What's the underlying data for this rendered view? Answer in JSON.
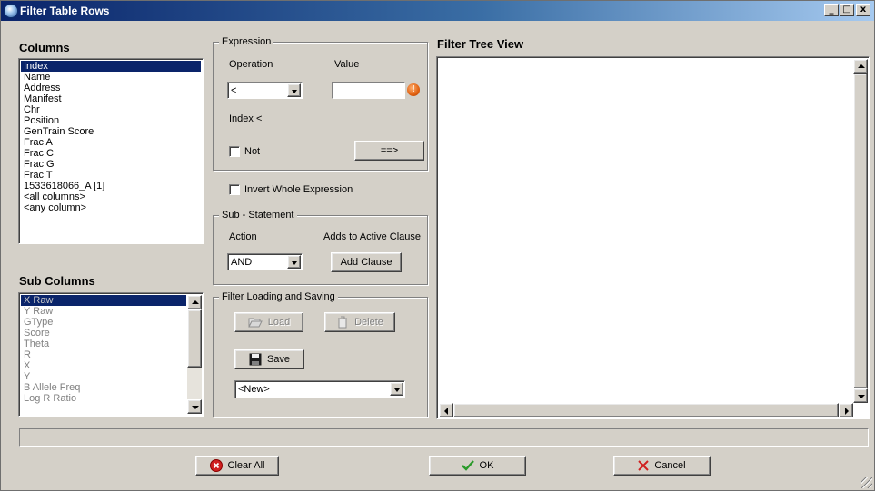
{
  "window": {
    "title": "Filter Table Rows"
  },
  "titlebar_buttons": {
    "minimize": "_",
    "maximize": "□",
    "close": "x"
  },
  "columns": {
    "heading": "Columns",
    "items": [
      "Index",
      "Name",
      "Address",
      "Manifest",
      "Chr",
      "Position",
      "GenTrain Score",
      "Frac A",
      "Frac C",
      "Frac G",
      "Frac T",
      "1533618066_A [1]",
      "<all columns>",
      "<any column>"
    ],
    "selected": "Index"
  },
  "sub_columns": {
    "heading": "Sub Columns",
    "items": [
      "X Raw",
      "Y Raw",
      "GType",
      "Score",
      "Theta",
      "R",
      "X",
      "Y",
      "B Allele Freq",
      "Log R Ratio"
    ],
    "selected": "X Raw"
  },
  "expression": {
    "group_label": "Expression",
    "operation_label": "Operation",
    "value_label": "Value",
    "operation_value": "<",
    "value_input": "",
    "warning_glyph": "!",
    "preview": "Index <",
    "not_label": "Not",
    "apply_button": "==>"
  },
  "invert": {
    "label": "Invert Whole Expression"
  },
  "sub_statement": {
    "group_label": "Sub - Statement",
    "action_label": "Action",
    "adds_label": "Adds to Active Clause",
    "action_value": "AND",
    "add_clause_button": "Add Clause"
  },
  "filter_io": {
    "group_label": "Filter Loading and Saving",
    "load_button": "Load",
    "delete_button": "Delete",
    "save_button": "Save",
    "filter_select": "<New>"
  },
  "tree": {
    "heading": "Filter Tree View"
  },
  "footer": {
    "clear_all": "Clear All",
    "ok": "OK",
    "cancel": "Cancel"
  },
  "colors": {
    "title_gradient_start": "#0a246a",
    "title_gradient_end": "#a6caf0",
    "selection": "#0a246a",
    "face": "#d4d0c8"
  }
}
